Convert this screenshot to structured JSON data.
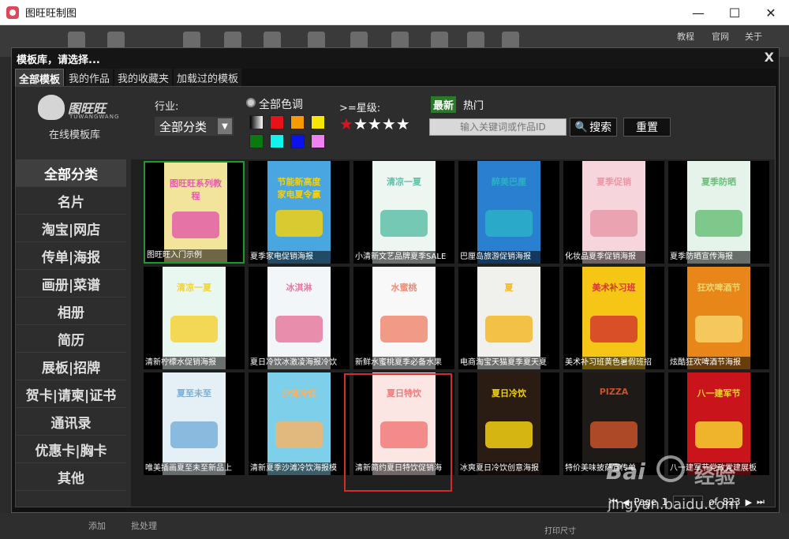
{
  "window": {
    "title": "图旺旺制图",
    "minimize_icon": "—",
    "maximize_icon": "☐",
    "close_icon": "✕"
  },
  "toolbar": {
    "links": [
      "教程",
      "官网",
      "关于"
    ]
  },
  "bottom": {
    "add_label": "添加",
    "batch_label": "批处理",
    "print_size_label": "打印尺寸"
  },
  "dialog": {
    "title": "模板库，请选择...",
    "close_label": "X",
    "tabs": [
      {
        "label": "全部模板",
        "active": true
      },
      {
        "label": "我的作品",
        "active": false
      },
      {
        "label": "我的收藏夹",
        "active": false
      },
      {
        "label": "加载过的模板",
        "active": false
      }
    ]
  },
  "logo": {
    "brand": "图旺旺",
    "brand_en": "TUWANGWANG",
    "subtitle": "在线模板库"
  },
  "filters": {
    "industry_label": "行业:",
    "industry_value": "全部分类",
    "color_label": "全部色调",
    "colors": [
      "gradient",
      "#e8101a",
      "#f59a00",
      "#f6e600",
      "#0a7a10",
      "#14f2ee",
      "#0a14e8",
      "#ee82ee"
    ],
    "star_label": ">=星级:",
    "stars_selected": 1,
    "stars_total": 5,
    "sort_latest": "最新",
    "sort_hot": "热门",
    "search_placeholder": "输入关键词或作品ID",
    "search_button": "搜索",
    "reset_button": "重置"
  },
  "categories": [
    {
      "label": "全部分类",
      "active": true
    },
    {
      "label": "名片",
      "active": false
    },
    {
      "label": "淘宝|网店",
      "active": false
    },
    {
      "label": "传单|海报",
      "active": false
    },
    {
      "label": "画册|菜谱",
      "active": false
    },
    {
      "label": "相册",
      "active": false
    },
    {
      "label": "简历",
      "active": false
    },
    {
      "label": "展板|招牌",
      "active": false
    },
    {
      "label": "贺卡|请柬|证书",
      "active": false
    },
    {
      "label": "通讯录",
      "active": false
    },
    {
      "label": "优惠卡|胸卡",
      "active": false
    },
    {
      "label": "其他",
      "active": false
    }
  ],
  "templates": [
    {
      "caption": "图旺旺入门示例",
      "head": "图旺旺系列教程",
      "bg": "#f2e49a",
      "accent": "#e45fa8",
      "selected": true
    },
    {
      "caption": "夏季家电促销海报",
      "head": "节能新高度 家电夏令赢",
      "bg": "#4aa6e0",
      "accent": "#f2d012",
      "selected": false
    },
    {
      "caption": "小清新文艺品牌夏季SALE",
      "head": "清凉一夏",
      "bg": "#eef6f2",
      "accent": "#5fc0a8",
      "selected": false
    },
    {
      "caption": "巴厘岛旅游促销海报",
      "head": "醉美巴厘",
      "bg": "#2a7fd0",
      "accent": "#2bb0c8",
      "selected": false
    },
    {
      "caption": "化妆品夏季促销海报",
      "head": "夏季促销",
      "bg": "#f6d6dc",
      "accent": "#e89aa8",
      "selected": false
    },
    {
      "caption": "夏季防晒宣传海报",
      "head": "夏季防晒",
      "bg": "#e6f3ea",
      "accent": "#6bbf7a",
      "selected": false
    },
    {
      "caption": "清新柠檬水促销海报",
      "head": "清凉一夏",
      "bg": "#e8f7f0",
      "accent": "#f3d23a",
      "selected": false
    },
    {
      "caption": "夏日冷饮冰激凌海报冷饮",
      "head": "冰淇淋",
      "bg": "#f2f6f8",
      "accent": "#e87aa0",
      "selected": false
    },
    {
      "caption": "新鲜水蜜桃夏季必备水果",
      "head": "水蜜桃",
      "bg": "#f8f8f8",
      "accent": "#f08a72",
      "selected": false
    },
    {
      "caption": "电商淘宝天猫夏季夏天夏",
      "head": "夏",
      "bg": "#f0f0ec",
      "accent": "#f4b82a",
      "selected": false
    },
    {
      "caption": "美术补习班黄色暑假班招",
      "head": "美术补习班",
      "bg": "#f5c616",
      "accent": "#d43a2a",
      "selected": false
    },
    {
      "caption": "炫酷狂欢啤酒节海报",
      "head": "狂欢啤酒节",
      "bg": "#e8861a",
      "accent": "#f6d46a",
      "selected": false
    },
    {
      "caption": "唯美插画夏至未至新品上",
      "head": "夏至未至",
      "bg": "#e4f0f6",
      "accent": "#7ab0d8",
      "selected": false
    },
    {
      "caption": "清新夏季沙滩冷饮海报模",
      "head": "沙滩冷饮",
      "bg": "#7ed0ea",
      "accent": "#f2b46a",
      "selected": false
    },
    {
      "caption": "清新简约夏日特饮促销海",
      "head": "夏日特饮",
      "bg": "#fbe6e4",
      "accent": "#f07a7a",
      "selected": false
    },
    {
      "caption": "冰爽夏日冷饮创意海报",
      "head": "夏日冷饮",
      "bg": "#2a1c12",
      "accent": "#f2d012",
      "selected": false
    },
    {
      "caption": "特价美味披萨宣传单",
      "head": "PIZZA",
      "bg": "#1e1a18",
      "accent": "#c8522a",
      "selected": false
    },
    {
      "caption": "八一建军节党政党建展板",
      "head": "八一建军节",
      "bg": "#c8141a",
      "accent": "#f6d030",
      "selected": false
    }
  ],
  "pager": {
    "first_icon": "⏮",
    "prev_icon": "◀",
    "page_label": "Page",
    "page_value": "1",
    "of_label": "of",
    "total_pages": "823",
    "next_icon": "▶",
    "last_icon": "⏭"
  },
  "watermark": {
    "brand": "Bai",
    "brand2": "经验",
    "url": "jingyan.baidu.com"
  }
}
